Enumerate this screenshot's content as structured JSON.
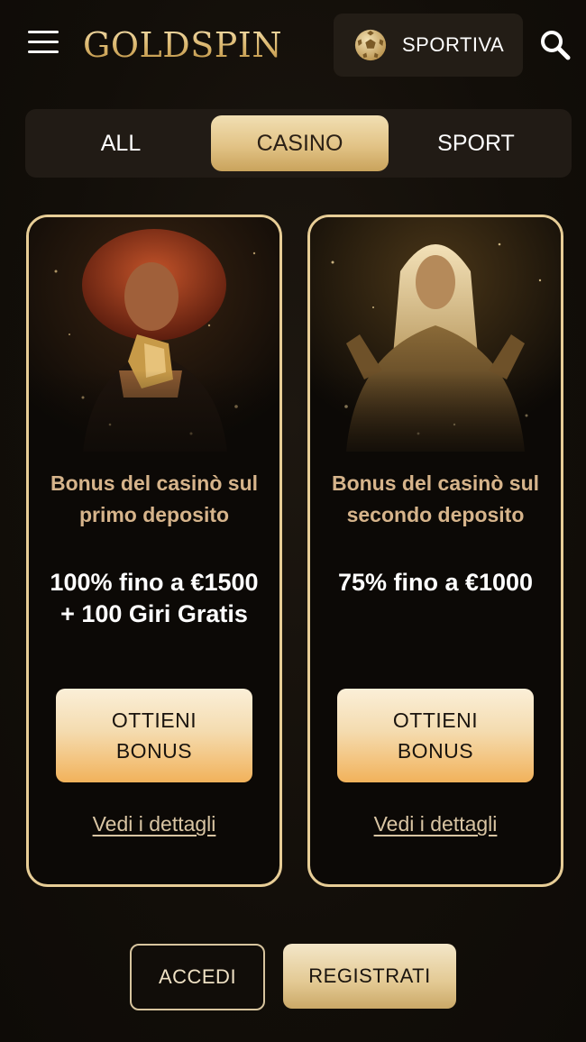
{
  "header": {
    "logo_text": "GOLDSPIN",
    "sport_button_label": "SPORTIVA",
    "icons": [
      "hamburger-menu-icon",
      "soccer-ball-icon",
      "search-icon"
    ]
  },
  "tabs": [
    {
      "label": "ALL",
      "active": false
    },
    {
      "label": "CASINO",
      "active": true
    },
    {
      "label": "SPORT",
      "active": false
    }
  ],
  "offers": [
    {
      "title": "Bonus del casinò sul primo deposito",
      "amount": "100% fino a €1500 + 100 Giri Gratis",
      "cta_label": "OTTIENI BONUS",
      "details_link": "Vedi i dettagli"
    },
    {
      "title": "Bonus del casinò sul secondo deposito",
      "amount": "75% fino a €1000",
      "cta_label": "OTTIENI BONUS",
      "details_link": "Vedi i dettagli"
    }
  ],
  "footer": {
    "login_label": "ACCEDI",
    "register_label": "REGISTRATI"
  },
  "colors": {
    "background": "#120e09",
    "gold_accent": "#e2c386",
    "card_border": "#e7cd96",
    "offer_title": "#d6b48b",
    "cta_gradient_bottom": "#f2b25b"
  }
}
